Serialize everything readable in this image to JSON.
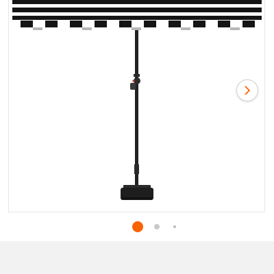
{
  "gallery": {
    "image": {
      "subject": "umbrella-product-photo",
      "colors": {
        "canopy_dark": "#151515",
        "canopy_light": "#ffffff",
        "pole": "#222222",
        "base": "#1e1e1e",
        "crank_accent": "#c0392b"
      }
    },
    "next_arrow_icon": "chevron-right-icon",
    "dots": [
      {
        "active": true
      },
      {
        "active": false
      },
      {
        "active": false
      }
    ],
    "colors": {
      "active_dot": "#f96302",
      "inactive_dot": "#c9c9c9",
      "arrow": "#f96302"
    }
  }
}
